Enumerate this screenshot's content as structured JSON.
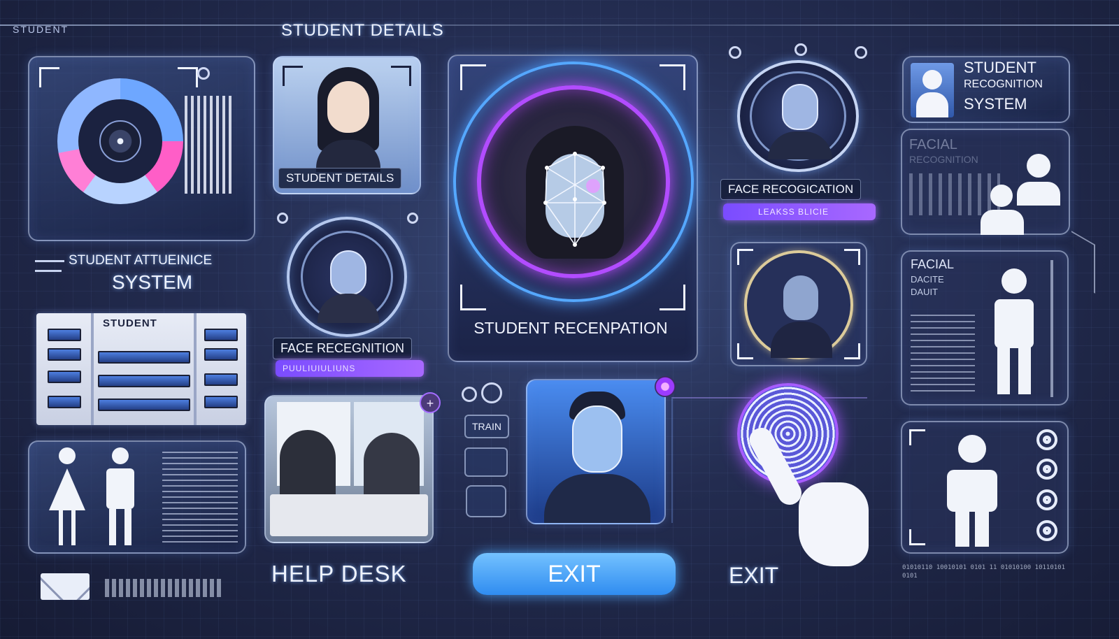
{
  "header": {
    "brand_label": "STUDENT",
    "section_title": "STUDENT DETAILS"
  },
  "left": {
    "attendance_title_line1": "STUDENT ATTUEINICE",
    "attendance_title_line2": "SYSTEM",
    "table_header": "STUDENT"
  },
  "center_left": {
    "student_card_label": "STUDENT DETAILS",
    "face_recognition_label": "FACE RECEGNITION",
    "face_recognition_bar": "PUULIUIULIUNS"
  },
  "hero": {
    "label": "STUDENT RECENPATION"
  },
  "right_middle": {
    "face_label": "FACE RECOGICATION",
    "face_bar": "LEAKSS BLICIE"
  },
  "right_panel": {
    "title": "STUDENT RECOGNITION SYSTEM",
    "title_lines": [
      "STUDENT",
      "RECOGNITION",
      "SYSTEM"
    ],
    "faded_heading": "FACIAL",
    "faded_subheading": "RECOGNITION",
    "facial_label": "FACIAL",
    "facial_sub1": "DACITE",
    "facial_sub2": "DAUIT"
  },
  "toolbar": {
    "train_label": "TRAIN"
  },
  "bottom": {
    "help_desk_label": "HELP DESK",
    "exit_button_label": "EXIT",
    "exit_text_label": "EXIT",
    "code_text": "01010110 10010101 0101 11 01010100 10110101 0101"
  },
  "colors": {
    "accent_blue": "#4aa8ff",
    "accent_purple": "#a868ff",
    "background": "#232c50"
  }
}
